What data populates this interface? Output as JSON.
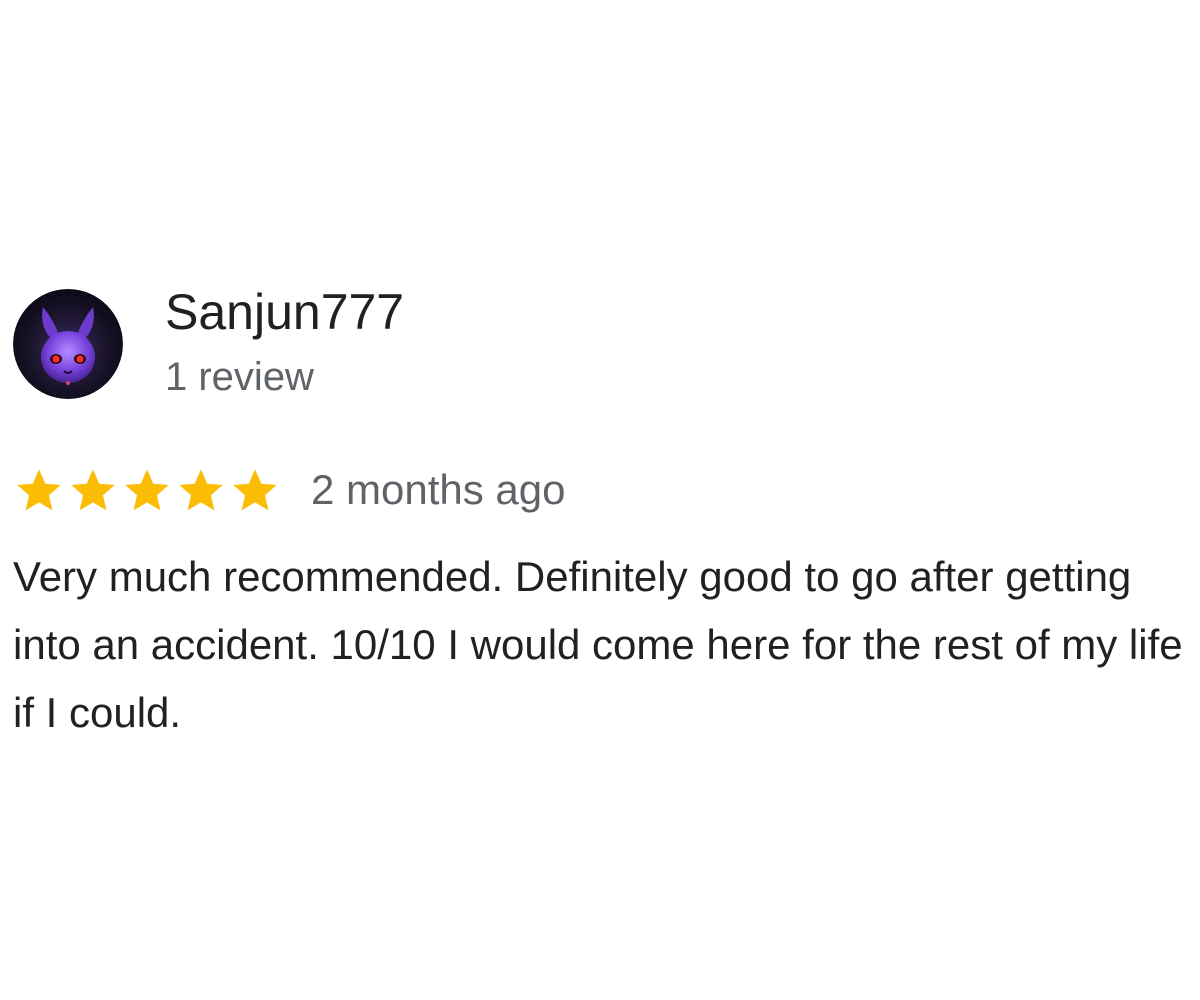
{
  "review": {
    "author": {
      "name": "Sanjun777",
      "review_count": "1 review",
      "avatar_icon": "purple-rabbit-avatar-icon"
    },
    "rating": {
      "stars": 5,
      "max_stars": 5,
      "star_color": "#fbbc04"
    },
    "time_ago": "2 months ago",
    "text": "Very much recommended. Definitely good to go after getting into an accident. 10/10 I would come here for the rest of my life if I could."
  }
}
